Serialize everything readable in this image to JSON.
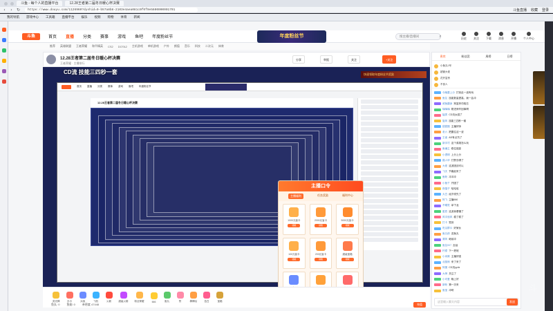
{
  "browser": {
    "tabs": [
      "斗鱼 - 每个人的直播平台",
      "12.28王者第二届冬日暖心杯决赛"
    ],
    "url": "https://www.douyu.com/1126960?dyshid=0-b57a8b8-2103e4aea081c0f0f9e5600000001701",
    "tools": [
      "斗鱼直播",
      "收藏",
      "登录"
    ],
    "bookmarks": [
      "我的导航",
      "游戏中心",
      "工具箱",
      "直播平台",
      "娱乐",
      "视频",
      "购物",
      "体育",
      "新闻"
    ]
  },
  "header": {
    "logo": "斗鱼",
    "nav": [
      "首页",
      "直播",
      "分类",
      "赛事",
      "游戏",
      "鱼吧",
      "年度粉丝节"
    ],
    "nav_active_index": 1,
    "banner": "年度粉丝节",
    "search_placeholder": "搜主播/直播间",
    "icons": [
      "历史",
      "关注",
      "下载",
      "消息",
      "开播",
      "个人中心"
    ]
  },
  "subnav": [
    "推荐",
    "英雄联盟",
    "王者荣耀",
    "和平精英",
    "CS2",
    "DOTA2",
    "主机游戏",
    "单机游戏",
    "户外",
    "颜值",
    "音乐",
    "科技",
    "二次元",
    "体育"
  ],
  "room": {
    "title": "12.28王者第二届冬日暖心杯决赛",
    "meta": "王者荣耀 · 主播排行",
    "buttons": [
      "分享",
      "举报",
      "关注",
      "+关注"
    ]
  },
  "video": {
    "overlay": "CD流    技能三四秒一套",
    "ad": "快速领取年度粉丝节奖励"
  },
  "nested": {
    "title": "12.28王者第二届冬日暖心杯决赛",
    "bar": [
      "首页",
      "直播",
      "分类",
      "赛事",
      "游戏",
      "鱼吧",
      "年度粉丝节"
    ]
  },
  "popup": {
    "title": "主播口令",
    "tabs": [
      "主播福利",
      "任务奖励",
      "福利中心"
    ],
    "tab_active_index": 0,
    "cards": [
      {
        "label": "1000元盲卡",
        "btn": "领取"
      },
      {
        "label": "2000元盲卡",
        "btn": "领取"
      },
      {
        "label": "5000元盲卡",
        "btn": "领取"
      },
      {
        "label": "100元盲卡",
        "btn": "领取"
      },
      {
        "label": "200元盲卡",
        "btn": "领取"
      },
      {
        "label": "超级宝箱",
        "btn": "领取"
      },
      {
        "label": "伯爵宝箱",
        "btn": "领取"
      },
      {
        "label": "黄金宝箱",
        "btn": "领取"
      },
      {
        "label": "荧光棒",
        "btn": "领取"
      }
    ]
  },
  "gifts": [
    {
      "label": "荧光棒",
      "color": "#f6c13a"
    },
    {
      "label": "办卡",
      "color": "#ff6f61"
    },
    {
      "label": "大咖",
      "color": "#6c8cff"
    },
    {
      "label": "飞机",
      "color": "#3bb3ff"
    },
    {
      "label": "火箭",
      "color": "#ff4b3e"
    },
    {
      "label": "超级火箭",
      "color": "#c24bff"
    },
    {
      "label": "粉丝荣耀",
      "color": "#ffb74a"
    },
    {
      "label": "666",
      "color": "#ffcc33"
    },
    {
      "label": "鱼丸",
      "color": "#5bc96b"
    },
    {
      "label": "赞",
      "color": "#ff8aa8"
    },
    {
      "label": "棒棒哒",
      "color": "#ff9f43"
    },
    {
      "label": "告白",
      "color": "#ff5d8f"
    },
    {
      "label": "宝箱",
      "color": "#d6a23a"
    }
  ],
  "bottom": {
    "left": "鱼丸: 0",
    "mid": "鱼翅: 0",
    "right": "充值",
    "count": "亲密度 47448",
    "pay": "充值"
  },
  "chat": {
    "tabs": [
      "贵宾",
      "粉丝团",
      "周榜",
      "日榜"
    ],
    "tab_active_index": 0,
    "rank": [
      "小鱼丸1号",
      "超管大佬",
      "花开富贵",
      "不良人"
    ],
    "messages": [
      {
        "name": "今晚要上分",
        "text": "打钩走一波有戏"
      },
      {
        "name": "鱼友",
        "text": "技能数量提高，我一会冲"
      },
      {
        "name": "咸鱼翻身",
        "text": "狗富贵勿相忘"
      },
      {
        "name": "嗨嗨嗨",
        "text": "刚进来咋回事啊"
      },
      {
        "name": "猛男",
        "text": "CD流太强了"
      },
      {
        "name": "旋风",
        "text": "技能三四秒一套"
      },
      {
        "name": "甜甜圈",
        "text": "主播好帅"
      },
      {
        "name": "老六",
        "text": "把握住这一波"
      },
      {
        "name": "王者",
        "text": "AD有点坑了"
      },
      {
        "name": "新手村",
        "text": "这个英雄怎么玩"
      },
      {
        "name": "鱼塘主",
        "text": "稳住能赢"
      },
      {
        "name": "小透明",
        "text": "上分上分"
      },
      {
        "name": "路人甲",
        "text": "打野去哪了"
      },
      {
        "name": "大佬",
        "text": "这波团战可以"
      },
      {
        "name": "飞天",
        "text": "节奏起来了"
      },
      {
        "name": "鱼粉",
        "text": "冲冲冲"
      },
      {
        "name": "小鱼干",
        "text": "开团了"
      },
      {
        "name": "夜猫子",
        "text": "哈哈哈"
      },
      {
        "name": "大白",
        "text": "经济领先了"
      },
      {
        "name": "阿飞",
        "text": "主播666"
      },
      {
        "name": "不睡觉",
        "text": "拿下龙"
      },
      {
        "name": "星辰",
        "text": "这波我看懂了"
      },
      {
        "name": "风中追风",
        "text": "稳了稳了"
      },
      {
        "name": "打卡",
        "text": "签到"
      },
      {
        "name": "吃瓜群众",
        "text": "好家伙"
      },
      {
        "name": "鱼丸侠",
        "text": "送鱼丸"
      },
      {
        "name": "清风",
        "text": "继续冲"
      },
      {
        "name": "鱼友007",
        "text": "加油"
      },
      {
        "name": "柠檬",
        "text": "下一把呢"
      },
      {
        "name": "小米粥",
        "text": "主播好强"
      },
      {
        "name": "北极熊",
        "text": "来了来了"
      },
      {
        "name": "阿狸",
        "text": "CD流yyds"
      },
      {
        "name": "大神",
        "text": "关注了"
      },
      {
        "name": "小可爱",
        "text": "晚上好"
      },
      {
        "name": "新粉",
        "text": "第一次来"
      },
      {
        "name": "鱼宝",
        "text": "冲呀"
      }
    ],
    "input_placeholder": "这里输入聊天内容",
    "send": "发送"
  },
  "watermark": "斗"
}
